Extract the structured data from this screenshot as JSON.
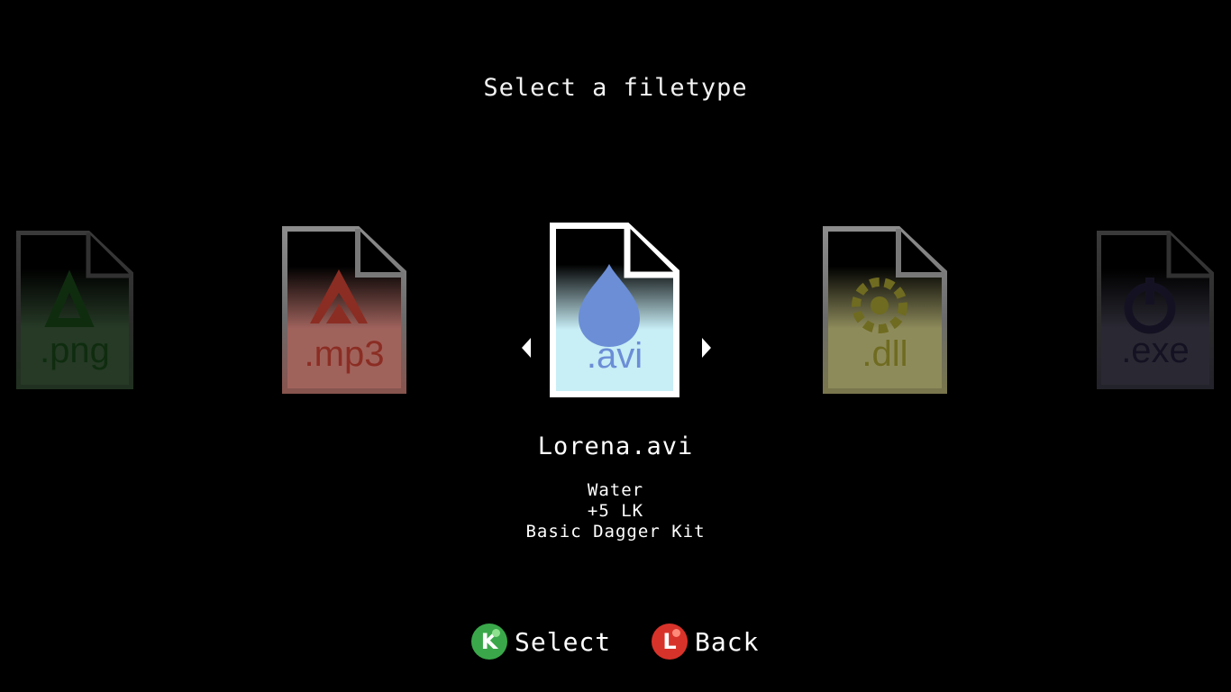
{
  "screen": {
    "title": "Select a filetype"
  },
  "carousel": {
    "items": [
      {
        "ext": ".png",
        "icon": "recycle-icon",
        "color": "#2f8a2f",
        "state": "far"
      },
      {
        "ext": ".mp3",
        "icon": "flame-icon",
        "color": "#b23a2e",
        "state": "near"
      },
      {
        "ext": ".avi",
        "icon": "water-drop-icon",
        "color": "#6b8ed6",
        "state": "selected"
      },
      {
        "ext": ".dll",
        "icon": "gear-icon",
        "color": "#8f8a2a",
        "state": "near"
      },
      {
        "ext": ".exe",
        "icon": "power-icon",
        "color": "#3f3a6a",
        "state": "far"
      }
    ],
    "prev_icon": "arrow-left-icon",
    "next_icon": "arrow-right-icon"
  },
  "selection": {
    "file_name": "Lorena.avi",
    "details": [
      "Water",
      "+5 LK",
      "Basic Dagger Kit"
    ]
  },
  "controls": {
    "select": {
      "key": "K",
      "label": "Select",
      "color": "#3aa84a"
    },
    "back": {
      "key": "L",
      "label": "Back",
      "color": "#d8332a"
    }
  }
}
